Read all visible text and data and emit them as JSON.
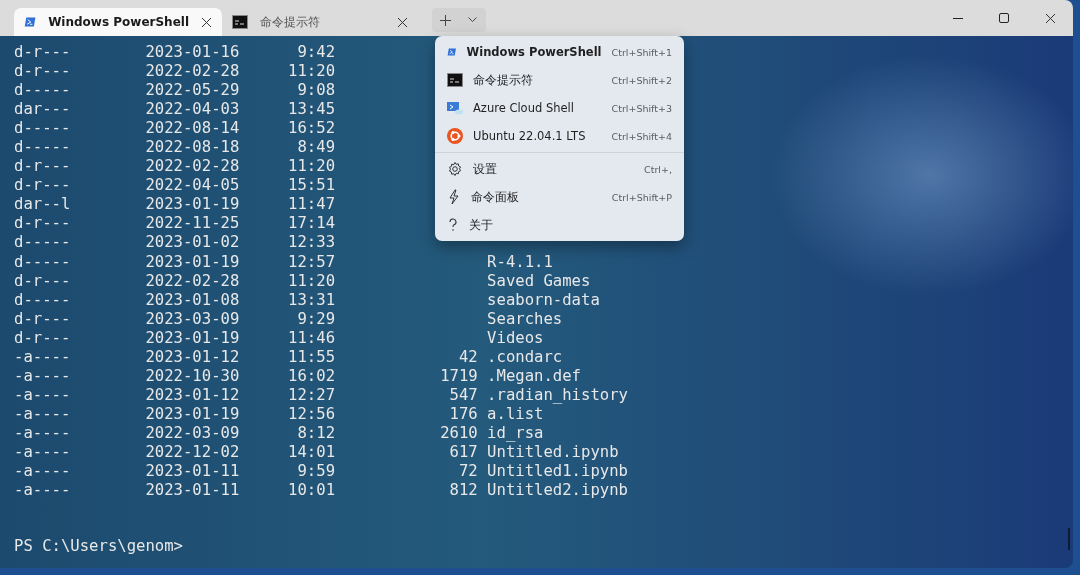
{
  "tabs": [
    {
      "kind": "powershell",
      "title": "Windows PowerShell",
      "selected": true
    },
    {
      "kind": "cmd",
      "title": "命令提示符",
      "selected": false
    }
  ],
  "listing": [
    {
      "mode": "d-r---",
      "date": "2023-01-16",
      "time": "9:42"
    },
    {
      "mode": "d-r---",
      "date": "2022-02-28",
      "time": "11:20"
    },
    {
      "mode": "d-----",
      "date": "2022-05-29",
      "time": "9:08"
    },
    {
      "mode": "dar---",
      "date": "2022-04-03",
      "time": "13:45"
    },
    {
      "mode": "d-----",
      "date": "2022-08-14",
      "time": "16:52"
    },
    {
      "mode": "d-----",
      "date": "2022-08-18",
      "time": "8:49"
    },
    {
      "mode": "d-r---",
      "date": "2022-02-28",
      "time": "11:20"
    },
    {
      "mode": "d-r---",
      "date": "2022-04-05",
      "time": "15:51"
    },
    {
      "mode": "dar--l",
      "date": "2023-01-19",
      "time": "11:47"
    },
    {
      "mode": "d-r---",
      "date": "2022-11-25",
      "time": "17:14"
    },
    {
      "mode": "d-----",
      "date": "2023-01-02",
      "time": "12:33"
    },
    {
      "mode": "d-----",
      "date": "2023-01-19",
      "time": "12:57",
      "name": "R-4.1.1"
    },
    {
      "mode": "d-r---",
      "date": "2022-02-28",
      "time": "11:20",
      "name": "Saved Games"
    },
    {
      "mode": "d-----",
      "date": "2023-01-08",
      "time": "13:31",
      "name": "seaborn-data"
    },
    {
      "mode": "d-r---",
      "date": "2023-03-09",
      "time": "9:29",
      "name": "Searches"
    },
    {
      "mode": "d-r---",
      "date": "2023-01-19",
      "time": "11:46",
      "name": "Videos"
    },
    {
      "mode": "-a----",
      "date": "2023-01-12",
      "time": "11:55",
      "length": "42",
      "name": ".condarc"
    },
    {
      "mode": "-a----",
      "date": "2022-10-30",
      "time": "16:02",
      "length": "1719",
      "name": ".Megan.def"
    },
    {
      "mode": "-a----",
      "date": "2023-01-12",
      "time": "12:27",
      "length": "547",
      "name": ".radian_history"
    },
    {
      "mode": "-a----",
      "date": "2023-01-19",
      "time": "12:56",
      "length": "176",
      "name": "a.list"
    },
    {
      "mode": "-a----",
      "date": "2022-03-09",
      "time": "8:12",
      "length": "2610",
      "name": "id_rsa"
    },
    {
      "mode": "-a----",
      "date": "2022-12-02",
      "time": "14:01",
      "length": "617",
      "name": "Untitled.ipynb"
    },
    {
      "mode": "-a----",
      "date": "2023-01-11",
      "time": "9:59",
      "length": "72",
      "name": "Untitled1.ipynb"
    },
    {
      "mode": "-a----",
      "date": "2023-01-11",
      "time": "10:01",
      "length": "812",
      "name": "Untitled2.ipynb"
    }
  ],
  "prompt": "PS C:\\Users\\genom>",
  "menu": {
    "profiles": [
      {
        "kind": "powershell",
        "label": "Windows PowerShell",
        "shortcut": "Ctrl+Shift+1"
      },
      {
        "kind": "cmd",
        "label": "命令提示符",
        "shortcut": "Ctrl+Shift+2"
      },
      {
        "kind": "azure",
        "label": "Azure Cloud Shell",
        "shortcut": "Ctrl+Shift+3"
      },
      {
        "kind": "ubuntu",
        "label": "Ubuntu 22.04.1 LTS",
        "shortcut": "Ctrl+Shift+4"
      }
    ],
    "actions": [
      {
        "kind": "settings",
        "label": "设置",
        "shortcut": "Ctrl+,"
      },
      {
        "kind": "palette",
        "label": "命令面板",
        "shortcut": "Ctrl+Shift+P"
      },
      {
        "kind": "about",
        "label": "关于"
      }
    ]
  }
}
